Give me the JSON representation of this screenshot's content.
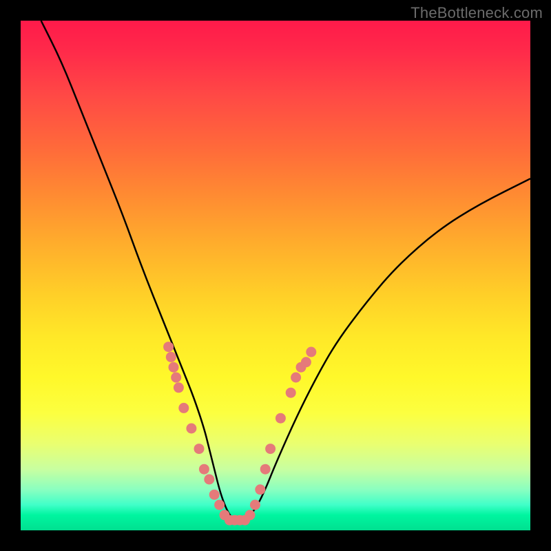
{
  "watermark": "TheBottleneck.com",
  "chart_data": {
    "type": "line",
    "title": "",
    "xlabel": "",
    "ylabel": "",
    "xlim": [
      0,
      100
    ],
    "ylim": [
      0,
      100
    ],
    "series": [
      {
        "name": "curve",
        "x": [
          4,
          8,
          12,
          16,
          20,
          24,
          28,
          30,
          32,
          34,
          36,
          37,
          38,
          39,
          40,
          41,
          42,
          43,
          44,
          46,
          48,
          50,
          54,
          58,
          62,
          68,
          74,
          82,
          90,
          100
        ],
        "y": [
          100,
          92,
          82,
          72,
          62,
          51,
          41,
          36,
          31,
          26,
          20,
          16,
          12,
          8,
          5,
          3,
          2,
          2,
          2,
          4,
          8,
          13,
          22,
          30,
          37,
          45,
          52,
          59,
          64,
          69
        ]
      }
    ],
    "dots": {
      "name": "markers",
      "x": [
        29.0,
        29.5,
        30.0,
        30.5,
        31.0,
        32.0,
        33.5,
        35.0,
        36.0,
        37.0,
        38.0,
        39.0,
        40.0,
        41.0,
        42.0,
        43.0,
        44.0,
        45.0,
        46.0,
        47.0,
        48.0,
        49.0,
        51.0,
        53.0,
        54.0,
        55.0,
        56.0,
        57.0
      ],
      "y": [
        36,
        34,
        32,
        30,
        28,
        24,
        20,
        16,
        12,
        10,
        7,
        5,
        3,
        2,
        2,
        2,
        2,
        3,
        5,
        8,
        12,
        16,
        22,
        27,
        30,
        32,
        33,
        35
      ]
    },
    "gradient_stops": [
      {
        "pos": 0,
        "color": "#ff1a4a"
      },
      {
        "pos": 50,
        "color": "#ffd028"
      },
      {
        "pos": 80,
        "color": "#fcff40"
      },
      {
        "pos": 100,
        "color": "#00e090"
      }
    ]
  }
}
